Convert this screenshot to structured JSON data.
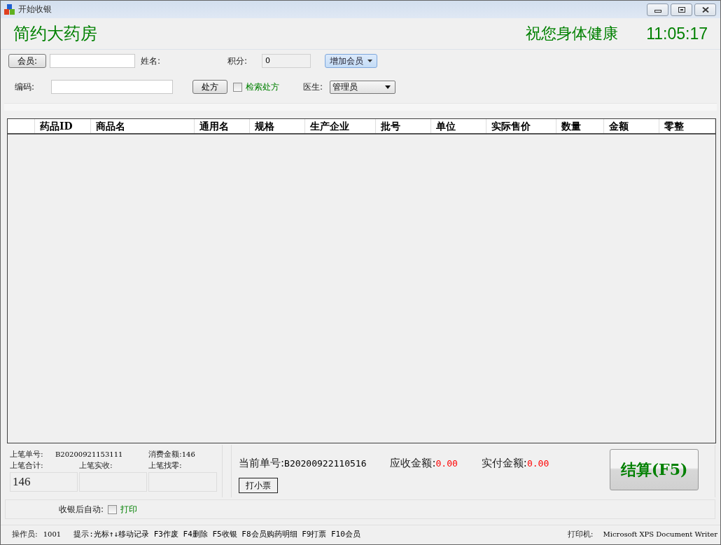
{
  "window": {
    "title": "开始收银"
  },
  "header": {
    "store_name": "简约大药房",
    "greeting": "祝您身体健康",
    "clock": "11:05:17"
  },
  "member_form": {
    "member_button": "会员:",
    "name_label": "姓名:",
    "points_label": "积分:",
    "points_value": "0",
    "add_member_button": "增加会员",
    "code_label": "编码:",
    "prescription_button": "处方",
    "search_prescription": {
      "label": "检索处方",
      "checked": false
    },
    "doctor_label": "医生:",
    "doctor_value": "管理员"
  },
  "table": {
    "columns": [
      "药品ID",
      "商品名",
      "通用名",
      "规格",
      "生产企业",
      "批号",
      "单位",
      "实际售价",
      "数量",
      "金额",
      "零整"
    ]
  },
  "last_sale": {
    "order_label": "上笔单号:",
    "order_value": "B20200921153111",
    "amount_label": "消费金额:",
    "amount_value": "146",
    "total_label": "上笔合计:",
    "received_label": "上笔实收:",
    "change_label": "上笔找零:",
    "total_value": "146"
  },
  "current_sale": {
    "order_label": "当前单号:",
    "order_value": "B20200922110516",
    "due_label": "应收金额:",
    "due_value": "0.00",
    "paid_label": "实付金额:",
    "paid_value": "0.00",
    "print_receipt_button": "打小票",
    "checkout_button": "结算(F5)"
  },
  "auto_after_checkout": {
    "label": "收银后自动:",
    "print": {
      "label": "打印",
      "checked": false
    }
  },
  "status_bar": {
    "operator_label": "操作员:",
    "operator_value": "1001",
    "hint": "提示:光标↑↓移动记录 F3作废 F4删除 F5收银 F8会员购药明细 F9打票 F10会员",
    "printer_label": "打印机:",
    "printer_value": "Microsoft XPS Document Writer"
  }
}
